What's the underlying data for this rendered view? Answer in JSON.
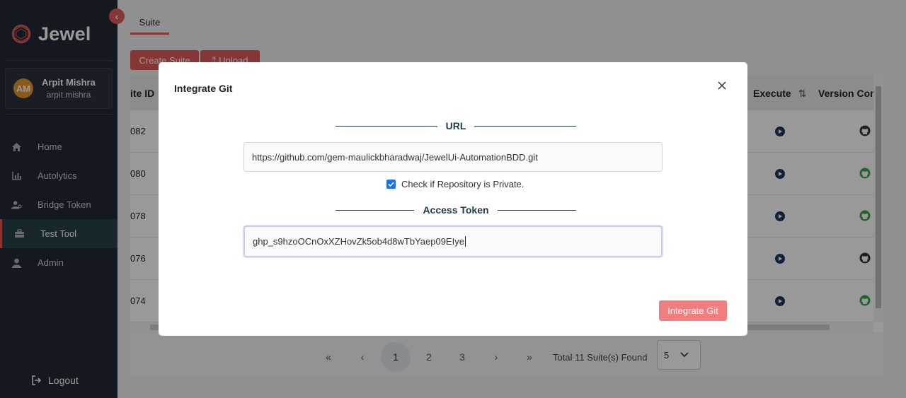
{
  "app": {
    "logo_text": "Jewel",
    "colors": {
      "accent": "#e25b5b",
      "sidebar_bg": "#222b35",
      "navy": "#1e3a4d"
    }
  },
  "sidebar": {
    "profile": {
      "initials": "AM",
      "name": "Arpit Mishra",
      "username": "arpit.mishra"
    },
    "items": [
      {
        "label": "Home",
        "icon": "home-icon"
      },
      {
        "label": "Autolytics",
        "icon": "bar-chart-icon"
      },
      {
        "label": "Bridge Token",
        "icon": "user-key-icon"
      },
      {
        "label": "Test Tool",
        "icon": "toolbox-icon",
        "active": true
      },
      {
        "label": "Admin",
        "icon": "person-icon"
      }
    ],
    "logout_label": "Logout"
  },
  "main": {
    "tab_label": "Suite",
    "create_label": "Create Suite",
    "upload_label": "Upload",
    "table": {
      "col_id": "ite ID",
      "col_execute": "Execute",
      "col_version": "Version Con",
      "rows": [
        {
          "id": "082",
          "git": "github-icon-dark"
        },
        {
          "id": "080",
          "git": "github-icon-green"
        },
        {
          "id": "078",
          "git": "github-icon-green"
        },
        {
          "id": "076",
          "git": "github-icon-dark"
        },
        {
          "id": "074",
          "git": "github-icon-green"
        }
      ]
    },
    "pagination": {
      "first": "«",
      "prev": "‹",
      "pages": [
        "1",
        "2",
        "3"
      ],
      "current": "1",
      "next": "›",
      "last": "»",
      "total_text": "Total 11 Suite(s) Found",
      "page_size": "5"
    }
  },
  "modal": {
    "title": "Integrate Git",
    "url_heading": "URL",
    "url_value": "https://github.com/gem-maulickbharadwaj/JewelUi-AutomationBDD.git",
    "private_label": "Check if Repository is Private.",
    "private_checked": true,
    "token_heading": "Access Token",
    "token_value": "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",
    "submit_label": "Integrate Git"
  }
}
